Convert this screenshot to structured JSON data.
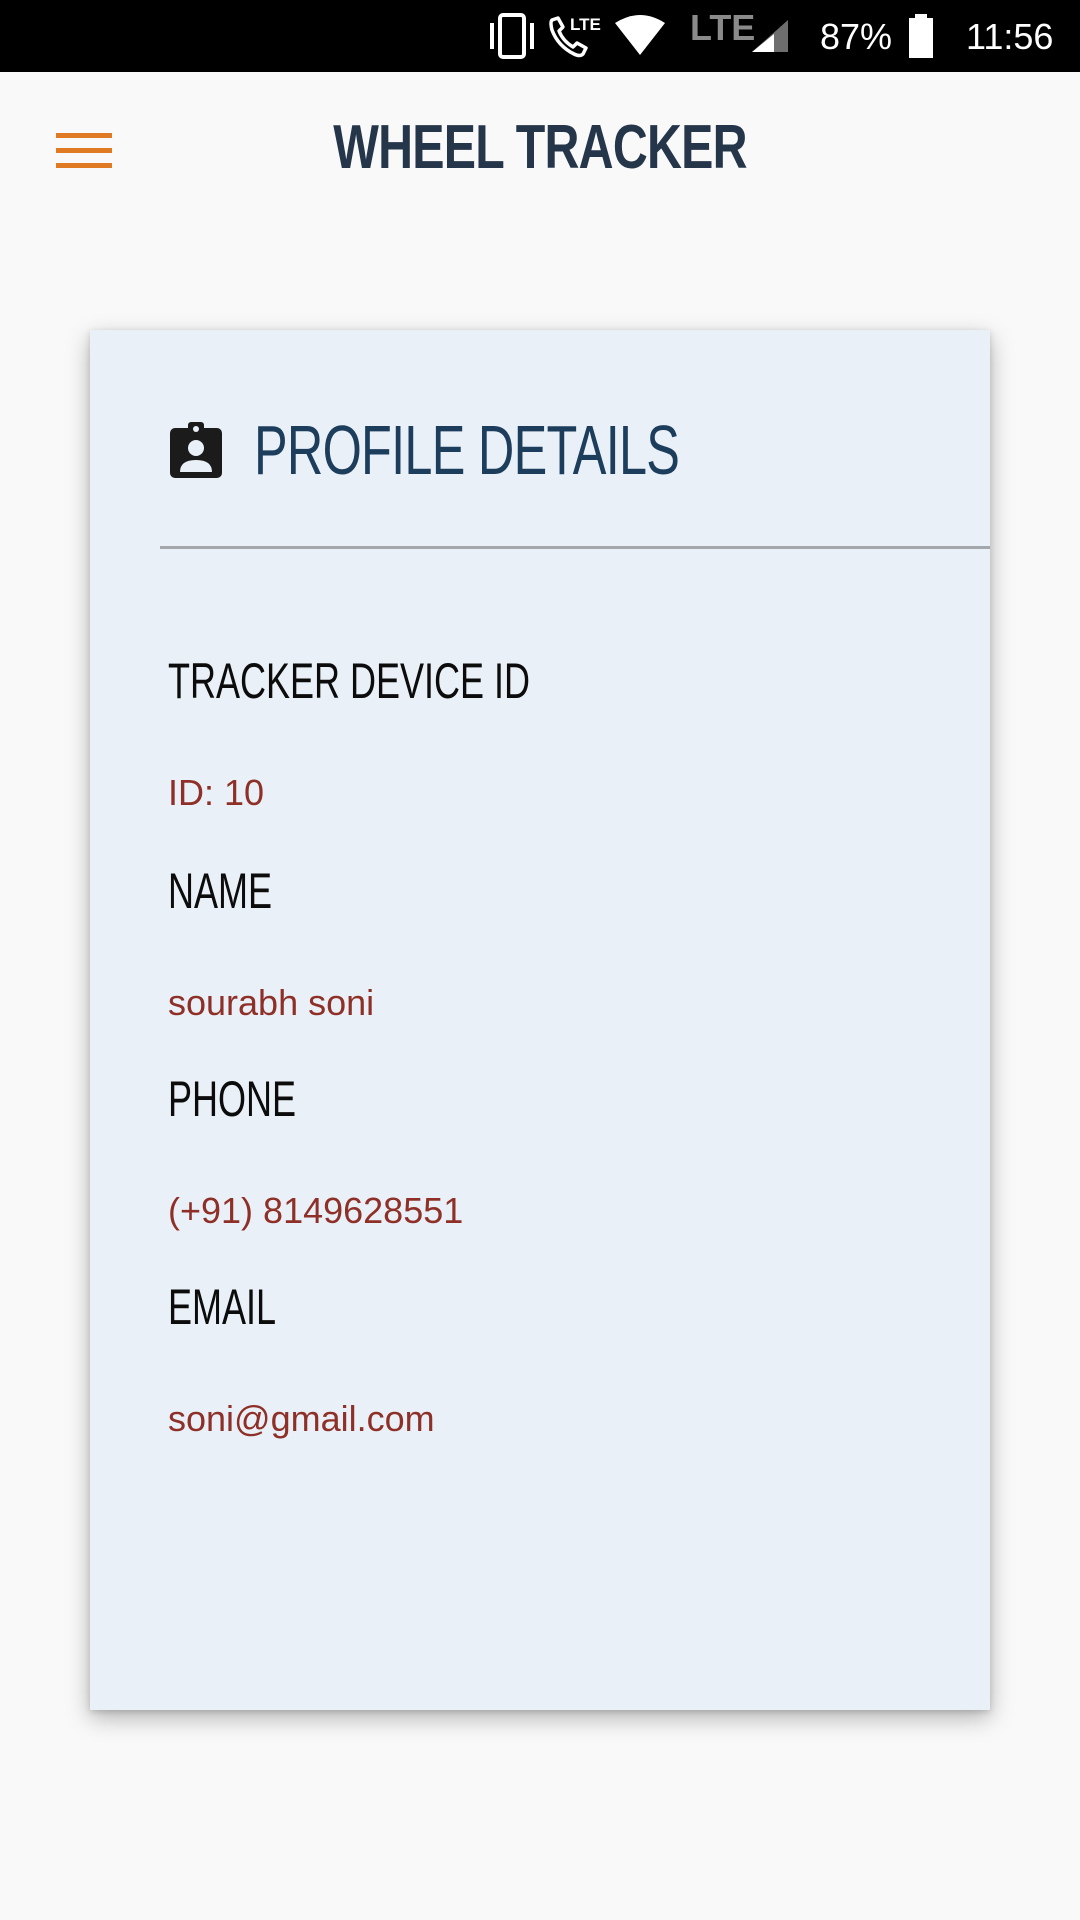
{
  "status_bar": {
    "battery_percent": "87%",
    "time": "11:56",
    "lte_label": "LTE",
    "icons": [
      "vibrate-icon",
      "volte-call-icon",
      "wifi-icon",
      "lte-icon",
      "signal-icon",
      "battery-icon"
    ]
  },
  "app_bar": {
    "title": "WHEEL TRACKER",
    "menu_icon": "hamburger-menu-icon",
    "accent_color": "#e07a22"
  },
  "profile": {
    "header_icon": "assignment-ind-icon",
    "title": "PROFILE DETAILS",
    "fields": [
      {
        "label": "TRACKER DEVICE ID",
        "value": "ID: 10"
      },
      {
        "label": "NAME",
        "value": "sourabh soni"
      },
      {
        "label": "PHONE",
        "value": "(+91) 8149628551"
      },
      {
        "label": "EMAIL",
        "value": "soni@gmail.com"
      }
    ]
  },
  "colors": {
    "title": "#26364a",
    "card_title": "#1c3d5c",
    "value": "#8e3028",
    "card_bg": "#eaf0f7"
  }
}
